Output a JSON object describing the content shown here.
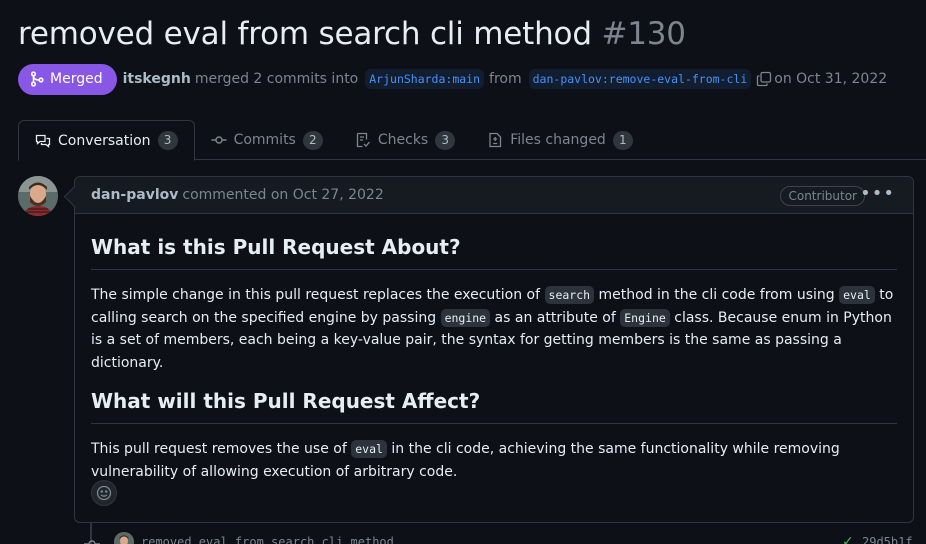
{
  "pr": {
    "title": "removed eval from search cli method",
    "number": "#130",
    "state_label": "Merged",
    "merger": "itskegnh",
    "merged_text": "merged 2 commits into",
    "base_branch": "ArjunSharda:main",
    "from_text": "from",
    "head_branch": "dan-pavlov:remove-eval-from-cli",
    "date_text": "on Oct 31, 2022"
  },
  "tabs": [
    {
      "label": "Conversation",
      "count": "3",
      "icon": "comment-discussion-icon"
    },
    {
      "label": "Commits",
      "count": "2",
      "icon": "git-commit-icon"
    },
    {
      "label": "Checks",
      "count": "3",
      "icon": "checklist-icon"
    },
    {
      "label": "Files changed",
      "count": "1",
      "icon": "file-diff-icon"
    }
  ],
  "comment": {
    "author": "dan-pavlov",
    "action_text": "commented on Oct 27, 2022",
    "badge": "Contributor",
    "heading1": "What is this Pull Request About?",
    "p1": {
      "t1": "The simple change in this pull request replaces the execution of ",
      "c1": "search",
      "t2": " method in the cli code from using ",
      "c2": "eval",
      "t3": " to calling search on the specified engine by passing ",
      "c3": "engine",
      "t4": " as an attribute of ",
      "c4": "Engine",
      "t5": " class. Because enum in Python is a set of members, each being a key-value pair, the syntax for getting members is the same as passing a dictionary."
    },
    "heading2": "What will this Pull Request Affect?",
    "p2": {
      "t1": "This pull request removes the use of ",
      "c1": "eval",
      "t2": " in the cli code, achieving the same functionality while removing vulnerability of allowing execution of arbitrary code."
    }
  },
  "commit": {
    "message": "removed eval from search cli method",
    "sha": "29d5b1f"
  },
  "colors": {
    "background": "#0d1117",
    "merged_purple": "#8957e5",
    "link_blue": "#4493f8",
    "success_green": "#3fb950"
  }
}
